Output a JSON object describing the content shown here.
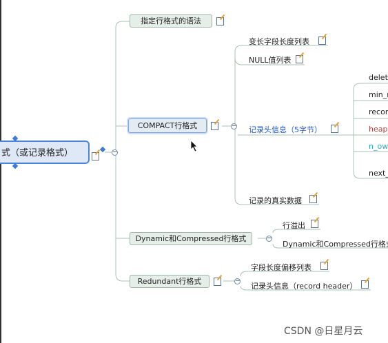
{
  "root": {
    "label": "式（或记录格式）"
  },
  "branches": {
    "syntax": "指定行格式的语法",
    "compact": "COMPACT行格式",
    "dynamic": "Dynamic和Compressed行格式",
    "redundant": "Redundant行格式"
  },
  "compact_children": {
    "var_len": "变长字段长度列表",
    "null_list": "NULL值列表",
    "record_header": "记录头信息（5字节）",
    "real_data": "记录的真实数据"
  },
  "header_fields": [
    "delete",
    "min_r",
    "record",
    "heap_",
    "n_ow",
    "next_"
  ],
  "dynamic_children": {
    "overflow": "行溢出",
    "dyn_compressed": "Dynamic和Compressed行格式"
  },
  "redundant_children": {
    "offset_list": "字段长度偏移列表",
    "record_header": "记录头信息（record header）"
  },
  "watermark": "CSDN @日星月云",
  "colors": {
    "accent": "#4a86d8",
    "line": "#a9c2b4",
    "blue_text": "#1f55c8",
    "red_text": "#b0413a",
    "teal_text": "#2aa9bf"
  }
}
